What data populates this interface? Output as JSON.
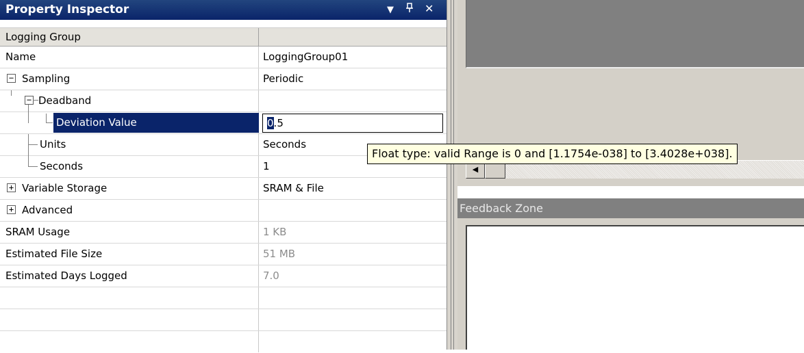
{
  "inspector": {
    "title": "Property Inspector",
    "dropdown_icon": "▼",
    "pin_icon": "ᵩ",
    "close_icon": "✕",
    "group_header": "Logging Group",
    "rows": [
      {
        "name": "Name",
        "value": "LoggingGroup01"
      },
      {
        "name": "Sampling",
        "value": "Periodic",
        "expander": "−"
      },
      {
        "name": "Deadband",
        "value": "",
        "expander": "−"
      },
      {
        "name": "Deviation Value",
        "value": "0.5",
        "value_selected_part": "0",
        "value_rest": ".5"
      },
      {
        "name": "Units",
        "value": "Seconds"
      },
      {
        "name": "Seconds",
        "value": "1"
      },
      {
        "name": "Variable Storage",
        "value": "SRAM & File",
        "expander": "+"
      },
      {
        "name": "Advanced",
        "value": "",
        "expander": "+"
      },
      {
        "name": "SRAM Usage",
        "value": "1 KB"
      },
      {
        "name": "Estimated File Size",
        "value": "51 MB"
      },
      {
        "name": "Estimated Days Logged",
        "value": "7.0"
      }
    ]
  },
  "tooltip": {
    "text": "Float type: valid Range is 0 and [1.1754e-038] to [3.4028e+038]."
  },
  "feedback": {
    "title": "Feedback Zone"
  },
  "scrollbar": {
    "left_arrow": "◀"
  },
  "colors": {
    "title_bar": "#0a246a",
    "selection": "#0a246a",
    "tooltip_bg": "#ffffe1",
    "panel_gray": "#d4d0c8"
  }
}
